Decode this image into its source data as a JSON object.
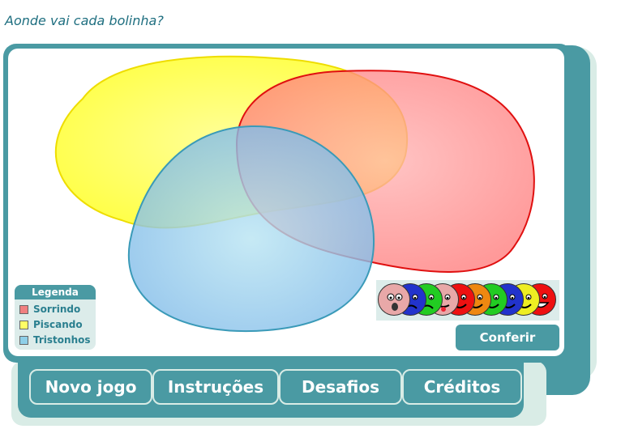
{
  "page": {
    "title": "Aonde vai cada bolinha?"
  },
  "legend": {
    "title": "Legenda",
    "items": [
      {
        "label": "Sorrindo",
        "color": "#f08080"
      },
      {
        "label": "Piscando",
        "color": "#ffff66"
      },
      {
        "label": "Tristonhos",
        "color": "#8ecfe8"
      }
    ]
  },
  "venn": {
    "sets": [
      {
        "name": "yellow-set",
        "fill": "#ffff33",
        "stroke": "#f0e000"
      },
      {
        "name": "red-set",
        "fill": "#ff6666",
        "stroke": "#e01010"
      },
      {
        "name": "blue-set",
        "fill": "#7cc8e8",
        "stroke": "#3a9ab8"
      }
    ]
  },
  "balls": [
    {
      "color": "#e8a8a8",
      "face": "surprised"
    },
    {
      "color": "#2233cc",
      "face": "sad"
    },
    {
      "color": "#22cc22",
      "face": "sad"
    },
    {
      "color": "#e8a8a8",
      "face": "tongue"
    },
    {
      "color": "#ee1111",
      "face": "smile"
    },
    {
      "color": "#ee8811",
      "face": "smile"
    },
    {
      "color": "#22cc22",
      "face": "smile"
    },
    {
      "color": "#2233cc",
      "face": "smile"
    },
    {
      "color": "#eeee22",
      "face": "wink"
    },
    {
      "color": "#ee1111",
      "face": "grin"
    }
  ],
  "buttons": {
    "check": "Conferir"
  },
  "tabs": [
    "Novo jogo",
    "Instruções",
    "Desafios",
    "Créditos"
  ]
}
